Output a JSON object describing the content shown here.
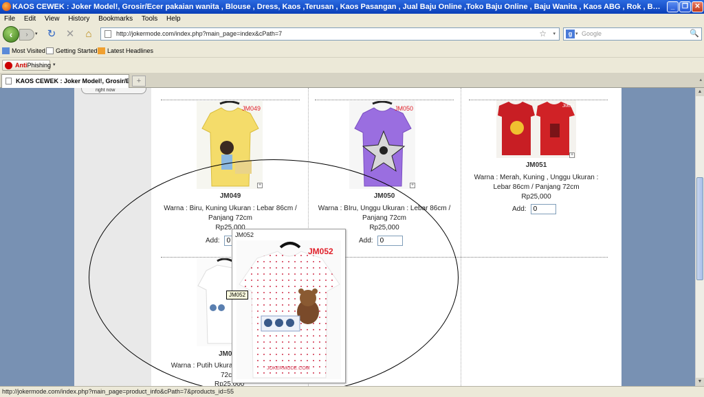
{
  "window": {
    "title": "KAOS CEWEK : Joker Model!, Grosir/Ecer pakaian wanita , Blouse , Dress, Kaos ,Terusan , Kaos Pasangan , Jual Baju Online ,Toko Baju Online , Baju Wanita , Kaos ABG , Rok , Baju Tidur , Jeans , Leging , Tank Top , Cardigan , Jaket - Mozilla Firefox",
    "minimize": "_",
    "maximize": "❐",
    "close": "✕"
  },
  "menu": [
    "File",
    "Edit",
    "View",
    "History",
    "Bookmarks",
    "Tools",
    "Help"
  ],
  "nav": {
    "url": "http://jokermode.com/index.php?main_page=index&cPath=7",
    "search_placeholder": "Google",
    "back_glyph": "‹",
    "forward_glyph": "›",
    "dropdown_glyph": "▾",
    "reload_glyph": "↻",
    "stop_glyph": "✕",
    "home_glyph": "⌂",
    "star_glyph": "☆",
    "search_glyph": "🔍",
    "google_glyph": "g"
  },
  "bookmarks": [
    "Most Visited",
    "Getting Started",
    "Latest Headlines"
  ],
  "antiphishing": {
    "part1": "Anti",
    "part2": "Phishing"
  },
  "tab": {
    "title": "KAOS CEWEK : Joker Model!, Grosir/Ec...",
    "new_tab_glyph": "+",
    "scroll_glyph": "▴"
  },
  "sidebar": {
    "right_now": "right now"
  },
  "products": [
    {
      "code": "JM049",
      "desc": "Warna : Biru, Kuning Ukuran : Lebar 86cm / Panjang 72cm",
      "price": "Rp25,000",
      "add_label": "Add:",
      "qty": "0",
      "tag": "JM049"
    },
    {
      "code": "JM050",
      "desc": "Warna : BIru, Unggu Ukuran : Lebar 86cm / Panjang 72cm",
      "price": "Rp25,000",
      "add_label": "Add:",
      "qty": "0",
      "tag": "JM050"
    },
    {
      "code": "JM051",
      "desc": "Warna : Merah, Kuning , Unggu Ukuran : Lebar 86cm / Panjang 72cm",
      "price": "Rp25,000",
      "add_label": "Add:",
      "qty": "0",
      "tag": "JM051"
    },
    {
      "code": "JM0",
      "desc": "Warna : Putih Ukuran :",
      "desc2": "72c",
      "price": "Rp25,000",
      "tag": "JM052"
    }
  ],
  "zoom_glyph": "+",
  "popup": {
    "title": "JM052",
    "tag": "JM052",
    "watermark": "JOKERMODE.COM"
  },
  "tooltip": "JM052",
  "status": "http://jokermode.com/index.php?main_page=product_info&cPath=7&products_id=55",
  "scroll": {
    "up": "▲",
    "down": "▼"
  },
  "colors": {
    "titlebar": "#0a3fb8",
    "chrome": "#ece9d8",
    "page_bg": "#7891b3",
    "tag_red": "#e0202a"
  }
}
